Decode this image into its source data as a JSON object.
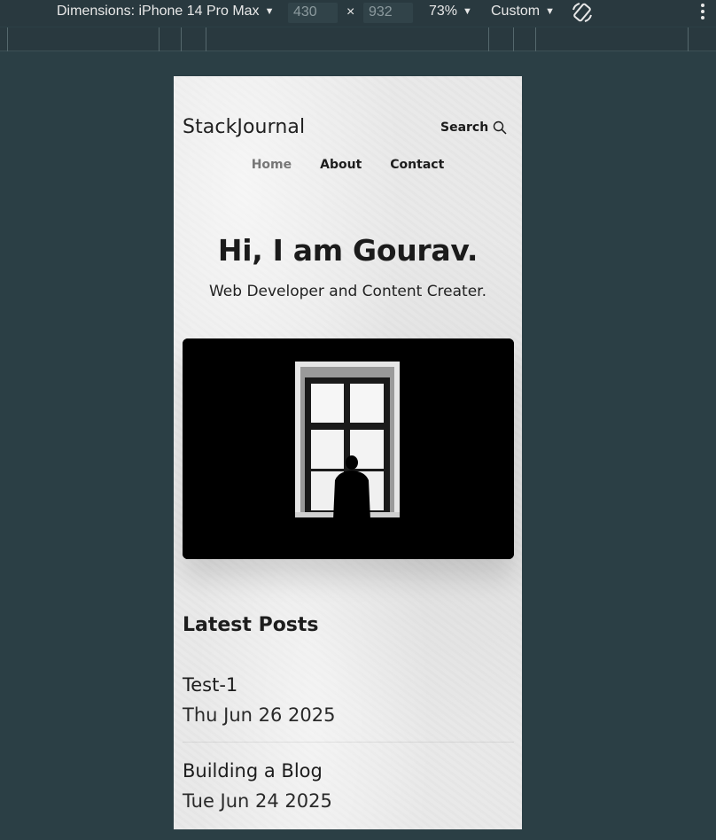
{
  "devtools": {
    "dimensions_label": "Dimensions: iPhone 14 Pro Max",
    "width_value": "430",
    "times": "×",
    "height_value": "932",
    "zoom": "73%",
    "throttle": "Custom"
  },
  "site": {
    "logo": "StackJournal",
    "search_label": "Search",
    "nav": {
      "home": "Home",
      "about": "About",
      "contact": "Contact"
    },
    "hero": {
      "title": "Hi, I am Gourav.",
      "subtitle": "Web Developer and Content Creater."
    },
    "latest_posts": {
      "heading": "Latest Posts",
      "posts": [
        {
          "title": "Test-1",
          "date": "Thu Jun 26 2025"
        },
        {
          "title": "Building a Blog",
          "date": "Tue Jun 24 2025"
        }
      ]
    }
  },
  "colors": {
    "devtools_bg": "#29393f",
    "page_bg": "#2b3f45",
    "nav_active": "#777777"
  }
}
